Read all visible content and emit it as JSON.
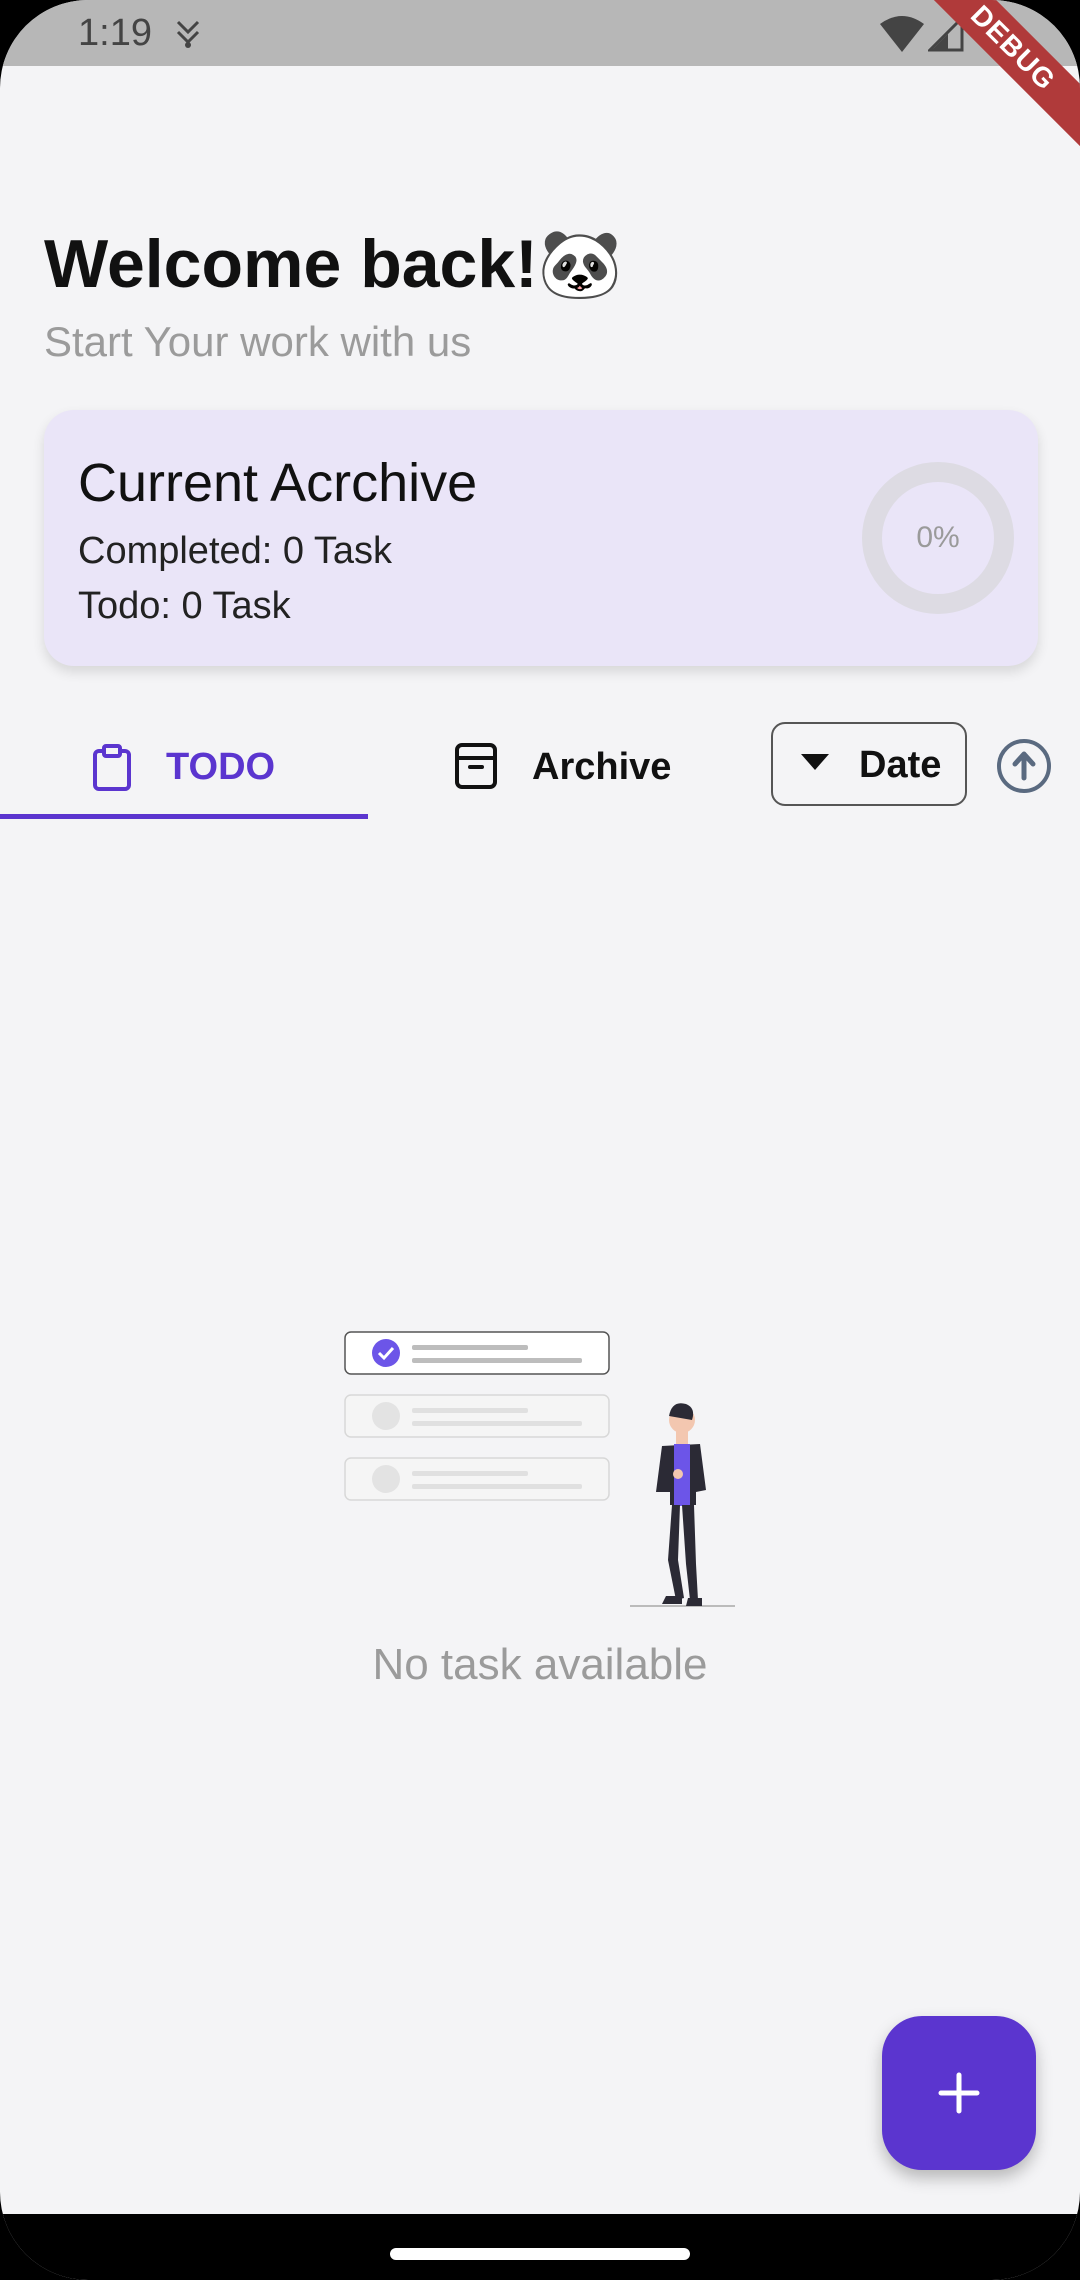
{
  "status_bar": {
    "time": "1:19",
    "debug_label": "DEBUG"
  },
  "header": {
    "title": "Welcome back!🐼",
    "subtitle": "Start Your work with us"
  },
  "summary_card": {
    "title": "Current Acrchive",
    "completed": "Completed: 0 Task",
    "todo": "Todo: 0 Task",
    "progress_label": "0%",
    "progress_fraction": 0,
    "background": "#eae5f8"
  },
  "tabs": [
    {
      "label": "TODO",
      "icon": "clipboard-icon",
      "selected": true
    },
    {
      "label": "Archive",
      "icon": "archive-box-icon",
      "selected": false
    }
  ],
  "sort": {
    "label": "Date",
    "direction_icon": "arrow-up-circle-icon"
  },
  "empty_state": {
    "message": "No task available",
    "illustration": "empty-tasks-illustration"
  },
  "fab": {
    "icon": "plus-icon",
    "color": "#5b35cf"
  },
  "colors": {
    "accent": "#5b35cf",
    "background": "#f4f4f6",
    "muted_text": "#9b9b9b"
  }
}
